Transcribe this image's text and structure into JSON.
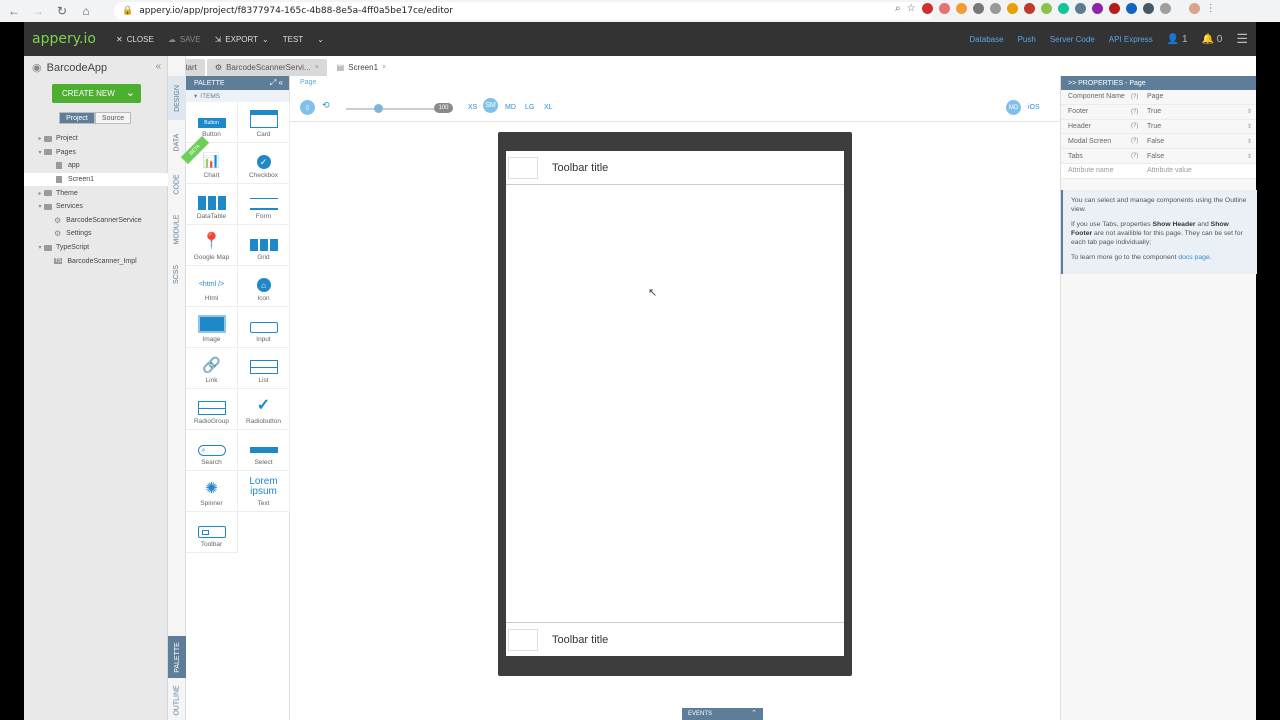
{
  "browser": {
    "url": "appery.io/app/project/f8377974-165c-4b88-8e5a-4ff0a5be17ce/editor",
    "back_icon": "back-arrow-icon",
    "forward_icon": "forward-arrow-icon",
    "reload_icon": "reload-icon",
    "home_icon": "home-icon"
  },
  "appbar": {
    "logo": "appery.io",
    "close": "CLOSE",
    "save": "SAVE",
    "export": "EXPORT",
    "test": "TEST",
    "links": [
      "Database",
      "Push",
      "Server Code",
      "API Express"
    ],
    "user_count": "1",
    "notif_count": "0"
  },
  "project": {
    "title": "BarcodeApp",
    "create_new": "CREATE NEW",
    "seg_project": "Project",
    "seg_source": "Source",
    "tree": [
      {
        "label": "Project",
        "level": 0,
        "type": "folder"
      },
      {
        "label": "Pages",
        "level": 0,
        "type": "folder"
      },
      {
        "label": "app",
        "level": 1,
        "type": "page"
      },
      {
        "label": "Screen1",
        "level": 1,
        "type": "page",
        "selected": true
      },
      {
        "label": "Theme",
        "level": 0,
        "type": "folder"
      },
      {
        "label": "Services",
        "level": 0,
        "type": "folder"
      },
      {
        "label": "BarcodeScannerService",
        "level": 1,
        "type": "gear"
      },
      {
        "label": "Settings",
        "level": 1,
        "type": "gear"
      },
      {
        "label": "TypeScript",
        "level": 0,
        "type": "folder"
      },
      {
        "label": "BarcodeScanner_Impl",
        "level": 1,
        "type": "ts"
      }
    ]
  },
  "vtabs": {
    "design": "DESIGN",
    "data": "DATA",
    "code": "CODE",
    "module": "MODULE",
    "scss": "SCSS",
    "palette": "PALETTE",
    "outline": "OUTLINE"
  },
  "palette": {
    "title": "PALETTE",
    "section": "ITEMS",
    "ribbon": "BETA",
    "items": [
      "Button",
      "Card",
      "Chart",
      "Checkbox",
      "DataTable",
      "Form",
      "Google Map",
      "Grid",
      "Html",
      "Icon",
      "Image",
      "Input",
      "Link",
      "List",
      "RadioGroup",
      "Radiobutton",
      "Search",
      "Select",
      "Spinner",
      "Text",
      "Toolbar"
    ],
    "button_glyph": "Button",
    "html_glyph": "<html />",
    "lorem": "Lorem ipsum"
  },
  "tabs": [
    "Start",
    "BarcodeScannerServi...",
    "Screen1"
  ],
  "canvas": {
    "crumb": "Page",
    "zoom": "100",
    "breakpoints": [
      "XS",
      "SM",
      "MD",
      "LG",
      "XL"
    ],
    "theme_md": "MD",
    "theme_ios": "iOS",
    "toolbar_title_top": "Toolbar title",
    "toolbar_title_bottom": "Toolbar title",
    "events": "EVENTS"
  },
  "properties": {
    "title": ">> PROPERTIES - Page",
    "rows": [
      {
        "k": "Component Name",
        "v": "Page"
      },
      {
        "k": "Footer",
        "v": "True"
      },
      {
        "k": "Header",
        "v": "True"
      },
      {
        "k": "Modal Screen",
        "v": "False"
      },
      {
        "k": "Tabs",
        "v": "False"
      }
    ],
    "attr_name": "Attribute name",
    "attr_value": "Attribute value",
    "help_q": "(?)",
    "info1": "You can select and manage components using the Outline view.",
    "info2_a": "If you use Tabs, properties ",
    "info2_b": "Show Header",
    "info2_c": " and ",
    "info2_d": "Show Footer",
    "info2_e": " are not availible for this page. They can be set for each tab page individually;",
    "info3_a": "To learn more go to the component ",
    "info3_link": "docs page",
    "info3_b": "."
  }
}
